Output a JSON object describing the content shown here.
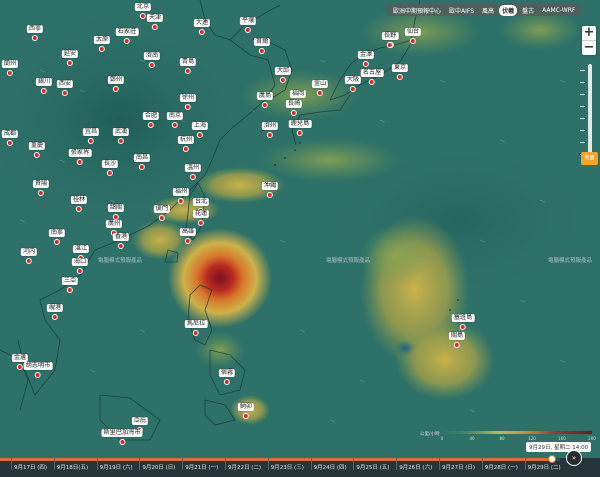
{
  "model_tabs": [
    {
      "label": "歐洲中期預報中心",
      "active": false
    },
    {
      "label": "歐中AIFS",
      "active": false
    },
    {
      "label": "風高",
      "active": false
    },
    {
      "label": "伏羲",
      "active": true
    },
    {
      "label": "盤古",
      "active": false
    },
    {
      "label": "AAMC-WRF",
      "active": false
    }
  ],
  "zoom": {
    "in_label": "+",
    "out_label": "−"
  },
  "altitude_handle_label": "地面",
  "watermark": "電腦模式預報產品",
  "legend": {
    "title": "公里/小時",
    "ticks": [
      "0",
      "40",
      "80",
      "120",
      "160",
      "200"
    ]
  },
  "timeline": {
    "days": [
      "9月17日 (四)",
      "9月18日(五)",
      "9月19日 (六)",
      "9月20日 (日)",
      "9月21日 (一)",
      "9月22日 (二)",
      "9月23日 (三)",
      "9月24日 (四)",
      "9月25日 (五)",
      "9月26日 (六)",
      "9月27日 (日)",
      "9月28日 (一)",
      "9月29日 (二)"
    ],
    "current_label": "9月29日, 星期二 14:00",
    "progress": 0.985,
    "play_label": "»"
  },
  "cities": [
    {
      "name": "北京"
    },
    {
      "name": "天津"
    },
    {
      "name": "大連"
    },
    {
      "name": "平壤"
    },
    {
      "name": "新潟"
    },
    {
      "name": "仙台"
    },
    {
      "name": "蘭州"
    },
    {
      "name": "太原"
    },
    {
      "name": "石家莊"
    },
    {
      "name": "首爾"
    },
    {
      "name": "西寧"
    },
    {
      "name": "延安"
    },
    {
      "name": "濟南"
    },
    {
      "name": "青島"
    },
    {
      "name": "金澤"
    },
    {
      "name": "東京"
    },
    {
      "name": "長野"
    },
    {
      "name": "銀川"
    },
    {
      "name": "大邱"
    },
    {
      "name": "名古屋"
    },
    {
      "name": "大阪"
    },
    {
      "name": "鄭州"
    },
    {
      "name": "釜山"
    },
    {
      "name": "西安"
    },
    {
      "name": "福岡"
    },
    {
      "name": "廣島"
    },
    {
      "name": "徐州"
    },
    {
      "name": "濟州"
    },
    {
      "name": "長崎"
    },
    {
      "name": "成都"
    },
    {
      "name": "宜昌"
    },
    {
      "name": "武漢"
    },
    {
      "name": "合肥"
    },
    {
      "name": "南京"
    },
    {
      "name": "上海"
    },
    {
      "name": "鹿兒島"
    },
    {
      "name": "重慶"
    },
    {
      "name": "張家界"
    },
    {
      "name": "杭州"
    },
    {
      "name": "長沙"
    },
    {
      "name": "南昌"
    },
    {
      "name": "溫州"
    },
    {
      "name": "貴陽"
    },
    {
      "name": "沖繩"
    },
    {
      "name": "福州"
    },
    {
      "name": "桂林"
    },
    {
      "name": "韶關"
    },
    {
      "name": "台北"
    },
    {
      "name": "廈門"
    },
    {
      "name": "花蓮"
    },
    {
      "name": "南寧"
    },
    {
      "name": "廣州"
    },
    {
      "name": "香港"
    },
    {
      "name": "高雄"
    },
    {
      "name": "河内"
    },
    {
      "name": "湛江"
    },
    {
      "name": "海口"
    },
    {
      "name": "三亞"
    },
    {
      "name": "峴港"
    },
    {
      "name": "塞班島"
    },
    {
      "name": "關島"
    },
    {
      "name": "馬尼拉"
    },
    {
      "name": "金邊"
    },
    {
      "name": "胡志明市"
    },
    {
      "name": "宿霧"
    },
    {
      "name": "納卯"
    },
    {
      "name": "亞庇"
    },
    {
      "name": "斯里巴加灣市"
    }
  ],
  "colors": {
    "accent": "#ea6a28",
    "handle": "#f3a22b",
    "base": "#2e7168"
  }
}
